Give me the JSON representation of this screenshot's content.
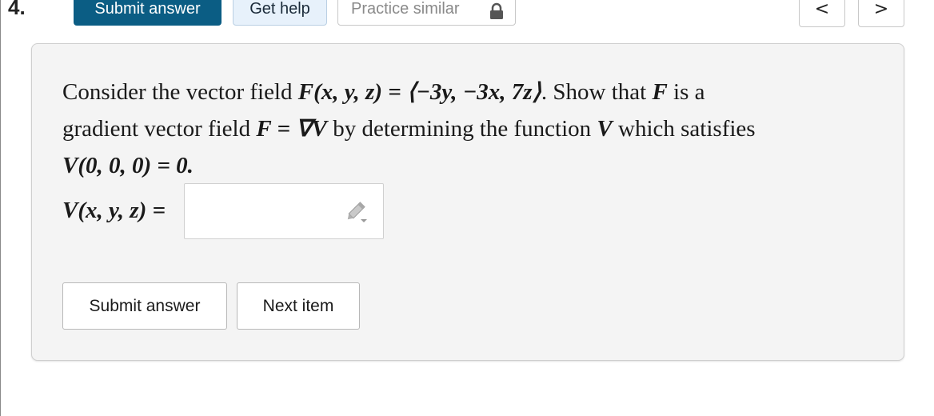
{
  "toolbar": {
    "question_number": "4.",
    "submit_label": "Submit answer",
    "help_label": "Get help",
    "practice_label": "Practice similar",
    "prev_icon": "chevron-left-icon",
    "next_icon": "chevron-right-icon",
    "lock_icon": "lock-icon",
    "prev_glyph": "<",
    "next_glyph": ">"
  },
  "problem": {
    "line1_text": "Consider the vector field ",
    "line1_math": "F(x, y, z) = ⟨−3y, −3x, 7z⟩",
    "line1_tail": ". Show that ",
    "line1_F": "F",
    "line1_end": " is a",
    "line2_start": "gradient vector field ",
    "line2_math": "F = ∇V",
    "line2_mid": " by determining the function ",
    "line2_V": "V",
    "line2_end": " which satisfies",
    "line3_math": "V(0, 0, 0) = 0."
  },
  "answer": {
    "label": "V(x, y, z) =",
    "value": "",
    "edit_icon": "pencil-icon"
  },
  "actions": {
    "submit_label": "Submit answer",
    "next_label": "Next item"
  },
  "colors": {
    "primary": "#0b5d84",
    "help_bg": "#e7f1fb",
    "card_bg": "#f4f4f4"
  }
}
